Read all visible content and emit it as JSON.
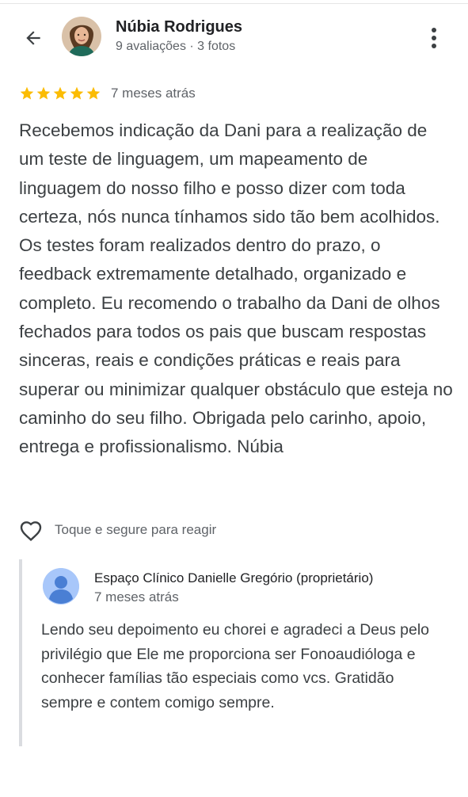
{
  "reviewer": {
    "name": "Núbia Rodrigues",
    "meta": "9 avaliações · 3 fotos",
    "avatar_icon": "profile-photo"
  },
  "header": {
    "back_icon": "arrow-left-icon",
    "more_icon": "more-vert-icon"
  },
  "review": {
    "rating": 5,
    "rating_max": 5,
    "star_color": "#fbbc04",
    "time": "7 meses atrás",
    "text": "Recebemos indicação da Dani para a realização de um teste de linguagem, um mapeamento de linguagem do nosso filho e posso dizer com toda certeza, nós nunca tínhamos sido tão bem acolhidos. Os testes foram realizados dentro do prazo, o feedback extremamente detalhado, organizado e completo. Eu recomendo o trabalho da Dani de olhos fechados para todos os pais que buscam respostas sinceras, reais e condições práticas e reais para superar ou minimizar qualquer obstáculo que esteja no caminho do seu filho. Obrigada pelo carinho, apoio, entrega e profissionalismo. Núbia"
  },
  "reaction": {
    "icon": "heart-outline-icon",
    "label": "Toque e segure para reagir"
  },
  "owner_reply": {
    "name": "Espaço Clínico Danielle Gregório (proprietário)",
    "time": "7 meses atrás",
    "avatar_icon": "default-profile-icon",
    "text": "Lendo seu depoimento eu chorei e agradeci a Deus pelo privilégio que Ele me proporciona ser Fonoaudióloga e conhecer famílias tão especiais como vcs. Gratidão sempre e contem comigo sempre."
  }
}
